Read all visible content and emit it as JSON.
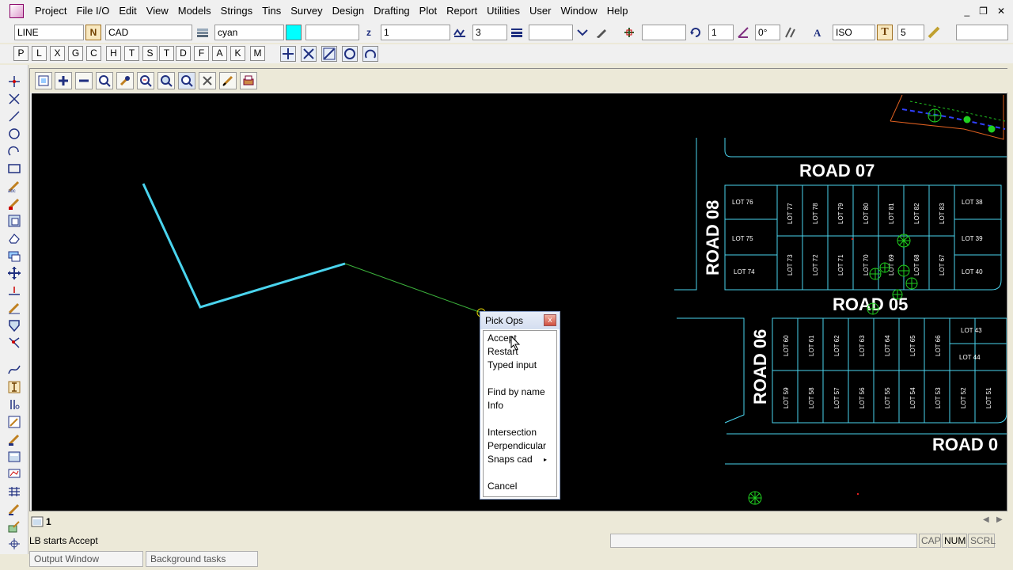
{
  "menu": [
    "Project",
    "File I/O",
    "Edit",
    "View",
    "Models",
    "Strings",
    "Tins",
    "Survey",
    "Design",
    "Drafting",
    "Plot",
    "Report",
    "Utilities",
    "User",
    "Window",
    "Help"
  ],
  "window_controls": [
    "_",
    "❐",
    "✕"
  ],
  "toolbar1": {
    "string_type": "LINE",
    "name_btn": "N",
    "model": "CAD",
    "colour": "cyan",
    "colour_hex": "#00ffff",
    "chainage_btn": "z",
    "field_1": "1",
    "weight": "3",
    "angle_value": "1",
    "angle_degrees": "0°",
    "text_style": "ISO",
    "text_btn": "T",
    "text_size": "5"
  },
  "snap_buttons": [
    "P",
    "L",
    "X",
    "G",
    "C",
    "H",
    "T",
    "S",
    "T",
    "D",
    "F",
    "A",
    "K",
    "M"
  ],
  "popup": {
    "title": "Pick Ops",
    "close": "x",
    "items": [
      "Accept",
      "Restart",
      "Typed input",
      "",
      "Find by name",
      "Info",
      "",
      "Intersection",
      "Perpendicular",
      "Snaps cad",
      "",
      "Cancel"
    ],
    "submenu_arrow": "▸"
  },
  "cad_labels": {
    "roads": [
      "ROAD 07",
      "ROAD 08",
      "ROAD 05",
      "ROAD 06",
      "ROAD 0"
    ],
    "lots_row_top_left": [
      "LOT 76",
      "LOT 75",
      "LOT 74"
    ],
    "lots_top_vertical_upper": [
      "LOT 77",
      "LOT 78",
      "LOT 79",
      "LOT 80",
      "LOT 81",
      "LOT 82",
      "LOT 83"
    ],
    "lots_top_vertical_lower": [
      "LOT 73",
      "LOT 72",
      "LOT 71",
      "LOT 70",
      "LOT 69",
      "LOT 68",
      "LOT 67"
    ],
    "lots_top_right": [
      "LOT 38",
      "LOT 39",
      "LOT 40"
    ],
    "lots_mid_vertical_upper": [
      "LOT 60",
      "LOT 61",
      "LOT 62",
      "LOT 63",
      "LOT 64",
      "LOT 65",
      "LOT 66"
    ],
    "lots_mid_right": [
      "LOT 43",
      "LOT 44"
    ],
    "lots_mid_vertical_lower": [
      "LOT 59",
      "LOT 58",
      "LOT 57",
      "LOT 56",
      "LOT 55",
      "LOT 54",
      "LOT 53",
      "LOT 52",
      "LOT 51"
    ]
  },
  "view_tab": "1",
  "status": {
    "message": "LB starts Accept",
    "indicators": [
      "CAP",
      "NUM",
      "SCRL"
    ]
  },
  "bottom_tabs": [
    "Output Window",
    "Background tasks"
  ],
  "scroll_arrows": [
    "◀",
    "▶"
  ]
}
